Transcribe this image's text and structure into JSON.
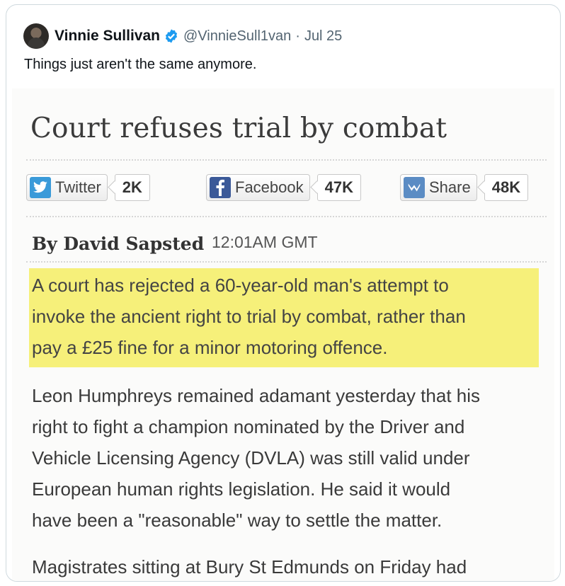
{
  "tweet": {
    "author_name": "Vinnie Sullivan",
    "handle": "@VinnieSull1van",
    "separator": "·",
    "date": "Jul 25",
    "text": "Things just aren't the same anymore."
  },
  "article": {
    "headline": "Court refuses trial by combat",
    "social": [
      {
        "label": "Twitter",
        "count": "2K",
        "icon": "twitter-icon",
        "color": "#3a9ad9"
      },
      {
        "label": "Facebook",
        "count": "47K",
        "icon": "facebook-icon",
        "color": "#3b5998"
      },
      {
        "label": "Share",
        "count": "48K",
        "icon": "share-icon",
        "color": "#5b8cc4"
      }
    ],
    "byline": "By David Sapsted",
    "timestamp": "12:01AM GMT",
    "lead": [
      "A court has rejected a 60-year-old man's attempt to",
      "invoke the ancient right to trial by combat, rather than",
      "pay a £25 fine for a minor motoring offence."
    ],
    "paragraph2": [
      "Leon Humphreys remained adamant yesterday that his",
      "right to fight a champion nominated by the Driver and",
      "Vehicle Licensing Agency (DVLA) was still valid under",
      "European human rights legislation. He said it would",
      "have been a \"reasonable\" way to settle the matter."
    ],
    "paragraph3": [
      "Magistrates sitting at Bury St Edmunds on Friday had"
    ]
  },
  "colors": {
    "verified": "#1d9bf0",
    "highlight": "#f6f07a",
    "muted_text": "#536471"
  }
}
